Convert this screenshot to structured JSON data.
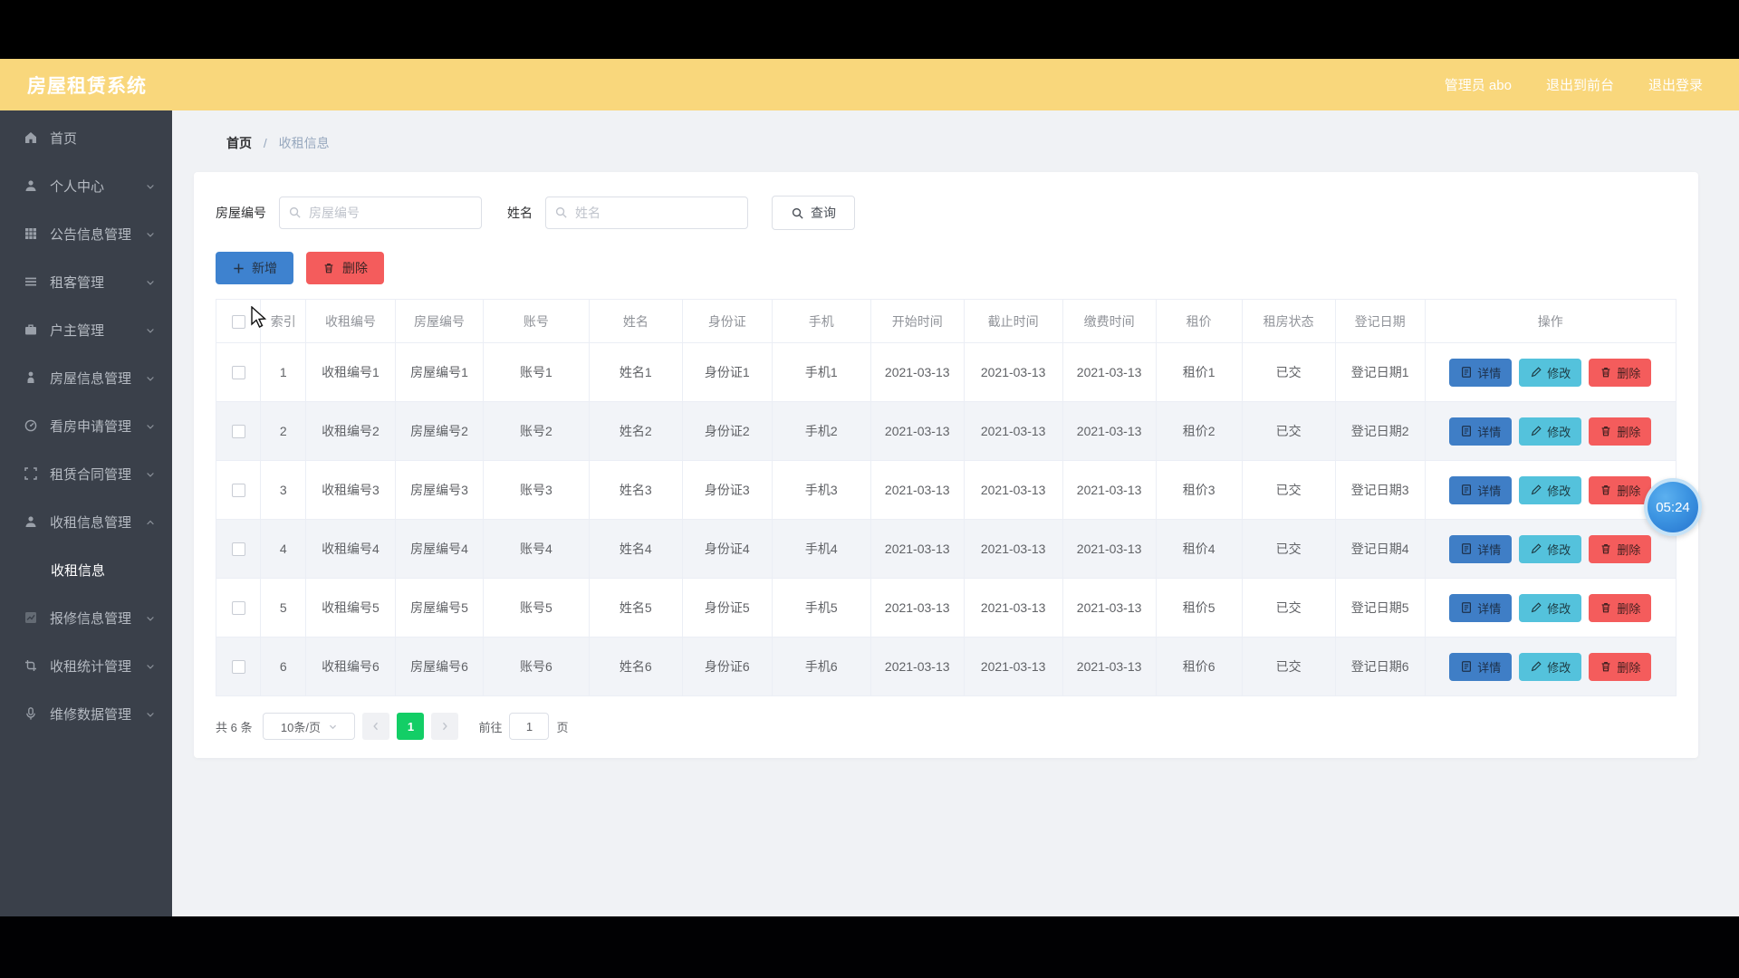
{
  "app": {
    "title": "房屋租赁系统"
  },
  "header": {
    "links": [
      {
        "label": "管理员 abo"
      },
      {
        "label": "退出到前台"
      },
      {
        "label": "退出登录"
      }
    ]
  },
  "sidebar": {
    "items": [
      {
        "label": "首页",
        "icon": "home-icon",
        "chevron": "none"
      },
      {
        "label": "个人中心",
        "icon": "user-icon",
        "chevron": "down"
      },
      {
        "label": "公告信息管理",
        "icon": "grid-icon",
        "chevron": "down"
      },
      {
        "label": "租客管理",
        "icon": "list-icon",
        "chevron": "down"
      },
      {
        "label": "户主管理",
        "icon": "briefcase-icon",
        "chevron": "down"
      },
      {
        "label": "房屋信息管理",
        "icon": "person-icon",
        "chevron": "down"
      },
      {
        "label": "看房申请管理",
        "icon": "gauge-icon",
        "chevron": "down"
      },
      {
        "label": "租赁合同管理",
        "icon": "crop-icon",
        "chevron": "down"
      },
      {
        "label": "收租信息管理",
        "icon": "user-icon",
        "chevron": "up"
      },
      {
        "label": "收租信息",
        "icon": "",
        "chevron": "none",
        "sub": true,
        "active": true
      },
      {
        "label": "报修信息管理",
        "icon": "chart-icon",
        "chevron": "down"
      },
      {
        "label": "收租统计管理",
        "icon": "crop2-icon",
        "chevron": "down"
      },
      {
        "label": "维修数据管理",
        "icon": "mic-icon",
        "chevron": "down"
      }
    ]
  },
  "breadcrumb": {
    "home": "首页",
    "separator": "/",
    "current": "收租信息"
  },
  "search": {
    "field1_label": "房屋编号",
    "field1_placeholder": "房屋编号",
    "field2_label": "姓名",
    "field2_placeholder": "姓名",
    "query_label": "查询"
  },
  "toolbar": {
    "add_label": "新增",
    "delete_label": "删除"
  },
  "table": {
    "headers": [
      "索引",
      "收租编号",
      "房屋编号",
      "账号",
      "姓名",
      "身份证",
      "手机",
      "开始时间",
      "截止时间",
      "缴费时间",
      "租价",
      "租房状态",
      "登记日期",
      "操作"
    ],
    "rows": [
      [
        "1",
        "收租编号1",
        "房屋编号1",
        "账号1",
        "姓名1",
        "身份证1",
        "手机1",
        "2021-03-13",
        "2021-03-13",
        "2021-03-13",
        "租价1",
        "已交",
        "登记日期1"
      ],
      [
        "2",
        "收租编号2",
        "房屋编号2",
        "账号2",
        "姓名2",
        "身份证2",
        "手机2",
        "2021-03-13",
        "2021-03-13",
        "2021-03-13",
        "租价2",
        "已交",
        "登记日期2"
      ],
      [
        "3",
        "收租编号3",
        "房屋编号3",
        "账号3",
        "姓名3",
        "身份证3",
        "手机3",
        "2021-03-13",
        "2021-03-13",
        "2021-03-13",
        "租价3",
        "已交",
        "登记日期3"
      ],
      [
        "4",
        "收租编号4",
        "房屋编号4",
        "账号4",
        "姓名4",
        "身份证4",
        "手机4",
        "2021-03-13",
        "2021-03-13",
        "2021-03-13",
        "租价4",
        "已交",
        "登记日期4"
      ],
      [
        "5",
        "收租编号5",
        "房屋编号5",
        "账号5",
        "姓名5",
        "身份证5",
        "手机5",
        "2021-03-13",
        "2021-03-13",
        "2021-03-13",
        "租价5",
        "已交",
        "登记日期5"
      ],
      [
        "6",
        "收租编号6",
        "房屋编号6",
        "账号6",
        "姓名6",
        "身份证6",
        "手机6",
        "2021-03-13",
        "2021-03-13",
        "2021-03-13",
        "租价6",
        "已交",
        "登记日期6"
      ]
    ],
    "actions": {
      "detail": "详情",
      "edit": "修改",
      "delete": "删除"
    }
  },
  "pagination": {
    "total": "共 6 条",
    "page_size": "10条/页",
    "current_page": "1",
    "goto_label": "前往",
    "goto_value": "1",
    "page_unit": "页"
  },
  "overlay": {
    "timer": "05:24"
  },
  "colors": {
    "header_yellow": "#f9d77c",
    "sidebar_bg": "#3a404a",
    "primary_blue": "#3e82cf",
    "detail_blue": "#3f7ec6",
    "edit_cyan": "#54c2dc",
    "danger_red": "#f45c5c",
    "pager_green": "#13ce66",
    "status_paid": "已交"
  }
}
